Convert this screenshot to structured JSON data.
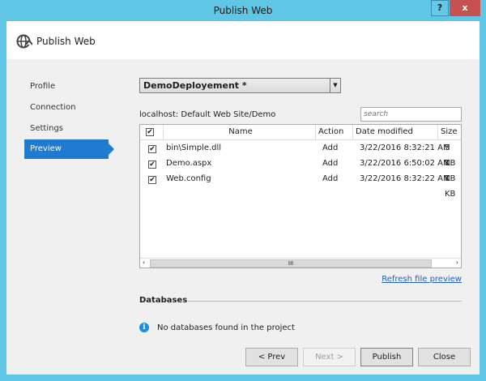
{
  "window": {
    "title": "Publish Web",
    "help_label": "?",
    "close_label": "x"
  },
  "header": {
    "title": "Publish Web",
    "icon": "globe-publish-icon"
  },
  "sidebar": {
    "items": [
      {
        "label": "Profile"
      },
      {
        "label": "Connection"
      },
      {
        "label": "Settings"
      },
      {
        "label": "Preview",
        "selected": true
      }
    ]
  },
  "profile_select": {
    "value": "DemoDeployement *"
  },
  "target": "localhost: Default Web Site/Demo",
  "search": {
    "placeholder": "search",
    "value": ""
  },
  "table": {
    "columns": [
      "Name",
      "Action",
      "Date modified",
      "Size"
    ],
    "all_checked": true,
    "rows": [
      {
        "checked": true,
        "name": "bin\\Simple.dll",
        "action": "Add",
        "date": "3/22/2016 8:32:21 AM",
        "size": "5 KB"
      },
      {
        "checked": true,
        "name": "Demo.aspx",
        "action": "Add",
        "date": "3/22/2016 6:50:02 AM",
        "size": "1 KB"
      },
      {
        "checked": true,
        "name": "Web.config",
        "action": "Add",
        "date": "3/22/2016 8:32:22 AM",
        "size": "1 KB"
      }
    ]
  },
  "refresh_link": "Refresh file preview",
  "databases": {
    "heading": "Databases",
    "message": "No databases found in the project"
  },
  "buttons": {
    "prev": "< Prev",
    "next": "Next >",
    "publish": "Publish",
    "close": "Close"
  },
  "colors": {
    "accent": "#1e7bd0",
    "border": "#5fc6e6",
    "close": "#c75050"
  }
}
